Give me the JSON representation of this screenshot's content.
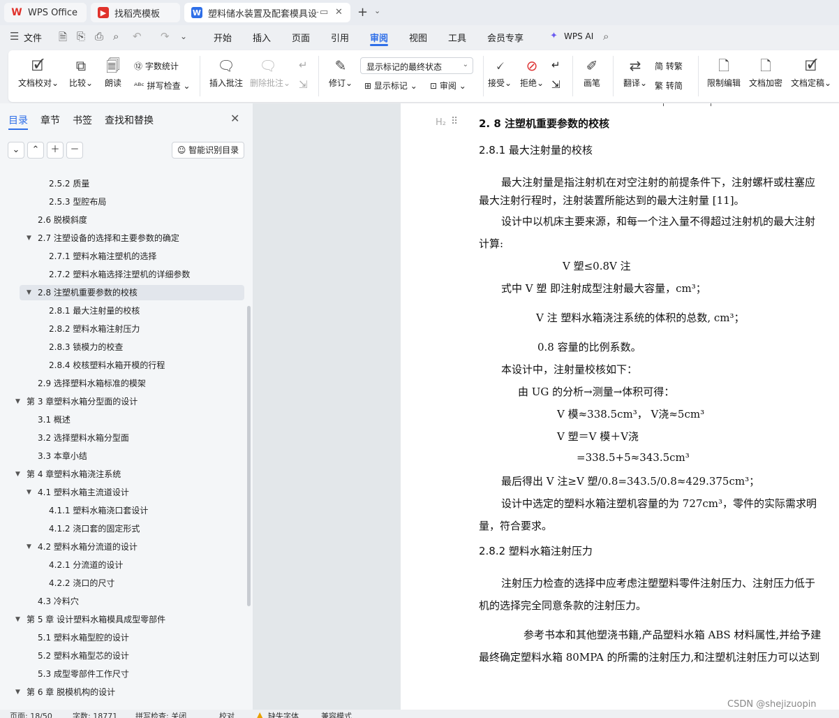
{
  "tabs": {
    "wps": "WPS Office",
    "templates": "找稻壳模板",
    "doc": "塑料储水装置及配套模具设计",
    "new_tab": "+"
  },
  "menu": {
    "file": "文件",
    "items": [
      "开始",
      "插入",
      "页面",
      "引用",
      "审阅",
      "视图",
      "工具",
      "会员专享"
    ],
    "active": "审阅",
    "wps_ai": "WPS AI"
  },
  "ribbon": {
    "doc_proof": "文档校对",
    "compare": "比较",
    "read_aloud": "朗读",
    "word_count": "字数统计",
    "spell_check": "拼写检查",
    "insert_comment": "插入批注",
    "delete_comment": "删除批注",
    "track": "修订",
    "markup_state": "显示标记的最终状态",
    "show_markup": "显示标记",
    "review": "审阅",
    "accept": "接受",
    "reject": "拒绝",
    "pen": "画笔",
    "translate": "翻译",
    "to_trad": "转繁",
    "to_simp": "转简",
    "restrict_edit": "限制编辑",
    "doc_encrypt": "文档加密",
    "doc_finalize": "文档定稿"
  },
  "nav": {
    "tabs": [
      "目录",
      "章节",
      "书签",
      "查找和替换"
    ],
    "smart_toc": "智能识别目录",
    "toc": [
      {
        "label": "2.5.2 质量",
        "level": 3
      },
      {
        "label": "2.5.3 型腔布局",
        "level": 3
      },
      {
        "label": "2.6 脱模斜度",
        "level": 2
      },
      {
        "label": "2.7 注塑设备的选择和主要参数的确定",
        "level": 2,
        "expanded": true
      },
      {
        "label": "2.7.1 塑料水箱注塑机的选择",
        "level": 3
      },
      {
        "label": "2.7.2 塑料水箱选择注塑机的详细参数",
        "level": 3
      },
      {
        "label": "2.8 注塑机重要参数的校核",
        "level": 2,
        "expanded": true,
        "active": true
      },
      {
        "label": "2.8.1 最大注射量的校核",
        "level": 3
      },
      {
        "label": "2.8.2 塑料水箱注射压力",
        "level": 3
      },
      {
        "label": "2.8.3 锁模力的校查",
        "level": 3
      },
      {
        "label": "2.8.4 校核塑料水箱开模的行程",
        "level": 3
      },
      {
        "label": "2.9 选择塑料水箱标准的模架",
        "level": 2
      },
      {
        "label": "第 3 章塑料水箱分型面的设计",
        "level": 1,
        "expanded": true
      },
      {
        "label": "3.1 概述",
        "level": 2
      },
      {
        "label": "3.2 选择塑料水箱分型面",
        "level": 2
      },
      {
        "label": "3.3  本章小结",
        "level": 2
      },
      {
        "label": "第 4 章塑料水箱浇注系统",
        "level": 1,
        "expanded": true
      },
      {
        "label": "4.1 塑料水箱主流道设计",
        "level": 2,
        "expanded": true
      },
      {
        "label": "4.1.1 塑料水箱浇口套设计",
        "level": 3
      },
      {
        "label": "4.1.2 浇口套的固定形式",
        "level": 3
      },
      {
        "label": "4.2 塑料水箱分流道的设计",
        "level": 2,
        "expanded": true
      },
      {
        "label": "4.2.1  分流道的设计",
        "level": 3
      },
      {
        "label": "4.2.2 浇口的尺寸",
        "level": 3
      },
      {
        "label": "4.3  冷料穴",
        "level": 2
      },
      {
        "label": "第 5 章   设计塑料水箱模具成型零部件",
        "level": 1,
        "expanded": true
      },
      {
        "label": "5.1 塑料水箱型腔的设计",
        "level": 2
      },
      {
        "label": "5.2 塑料水箱型芯的设计",
        "level": 2
      },
      {
        "label": "5.3 成型零部件工作尺寸",
        "level": 2
      },
      {
        "label": "第 6 章   脱模机构的设计",
        "level": 1,
        "expanded": true
      }
    ]
  },
  "doc": {
    "h2_marker": "H₂",
    "lines": [
      {
        "text": "2. 8 注塑机重要参数的校核",
        "style": "heading"
      },
      {
        "text": "2.8.1 最大注射量的校核",
        "style": "sub"
      },
      {
        "text": "最大注射量是指注射机在对空注射的前提条件下，注射螺杆或柱塞应"
      },
      {
        "text": "最大注射行程时，注射装置所能达到的最大注射量 [11]。"
      },
      {
        "text": "设计中以机床主要来源，和每一个注入量不得超过注射机的最大注射"
      },
      {
        "text": "计算:"
      },
      {
        "text": "V 塑≤0.8V 注"
      },
      {
        "text": "式中    V 塑        即注射成型注射最大容量，cm³；"
      },
      {
        "text": "V 注       塑料水箱浇注系统的体积的总数, cm³；"
      },
      {
        "text": "0.8      容量的比例系数。"
      },
      {
        "text": "本设计中，注射量校核如下："
      },
      {
        "text": "由 UG 的分析→测量→体积可得："
      },
      {
        "text": "V 模≈338.5cm³，  V浇≈5cm³"
      },
      {
        "text": "V 塑＝V 模＋V浇"
      },
      {
        "text": "=338.5+5≈343.5cm³"
      },
      {
        "text": "最后得出 V 注≥V 塑/0.8=343.5/0.8≈429.375cm³；"
      },
      {
        "text": "设计中选定的塑料水箱注塑机容量的为 727cm³，零件的实际需求明"
      },
      {
        "text": "量，符合要求。"
      },
      {
        "text": "2.8.2 塑料水箱注射压力",
        "style": "sub"
      },
      {
        "text": "注射压力检查的选择中应考虑注塑塑料零件注射压力、注射压力低于"
      },
      {
        "text": "机的选择完全同意条款的注射压力。"
      },
      {
        "text": "参考书本和其他塑浇书籍,产品塑料水箱 ABS 材料属性,并给予建"
      },
      {
        "text": "最终确定塑料水箱 80MPA 的所需的注射压力,和注塑机注射压力可以达到"
      }
    ]
  },
  "status": {
    "page": "页面: 18/50",
    "words": "字数: 18771",
    "spell": "拼写检查: 关闭",
    "proof": "校对",
    "missing_font": "缺失字体",
    "compat": "兼容模式"
  },
  "watermark": "CSDN @shejizuopin"
}
